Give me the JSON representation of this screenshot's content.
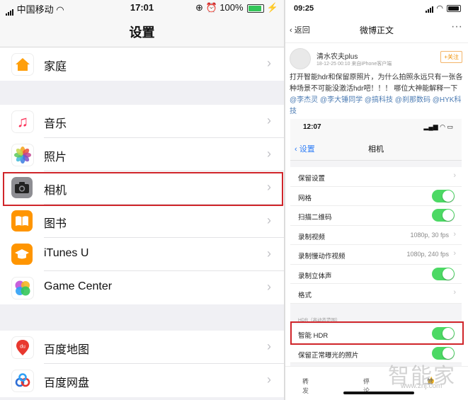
{
  "left": {
    "status": {
      "carrier": "中国移动",
      "time": "17:01",
      "battery": "100%"
    },
    "nav_title": "设置",
    "groups": [
      {
        "items": [
          {
            "label": "家庭",
            "icon": "home-icon",
            "color": "#ffffff"
          }
        ]
      },
      {
        "items": [
          {
            "label": "音乐",
            "icon": "music-icon",
            "color": "#ffffff"
          },
          {
            "label": "照片",
            "icon": "photos-icon",
            "color": "#ffffff"
          },
          {
            "label": "相机",
            "icon": "camera-icon",
            "color": "#8e8e93"
          },
          {
            "label": "图书",
            "icon": "books-icon",
            "color": "#ff9500"
          },
          {
            "label": "iTunes U",
            "icon": "itunes-u-icon",
            "color": "#ff9500"
          },
          {
            "label": "Game Center",
            "icon": "game-center-icon",
            "color": "#ffffff"
          }
        ]
      },
      {
        "items": [
          {
            "label": "百度地图",
            "icon": "baidu-map-icon",
            "color": "#ffffff"
          },
          {
            "label": "百度网盘",
            "icon": "baidu-netdisk-icon",
            "color": "#ffffff"
          }
        ]
      }
    ],
    "highlighted": "相机",
    "highlight_color": "#d0252a"
  },
  "right": {
    "status": {
      "time": "09:25"
    },
    "nav": {
      "back": "返回",
      "title": "微博正文",
      "more": "···"
    },
    "post": {
      "username": "清水农夫plus",
      "meta": "18-12-25 00:10  来自iPhone客户端",
      "follow": "+关注",
      "text": "打开智能hdr和保留原照片，为什么拍照永远只有一张各种场景不可能没激活hdr吧！！！ 哪位大神能解释一下",
      "mentions": "@李杰灵 @李大锤同学 @搞科技 @刹那数码 @HYK科技"
    },
    "inner": {
      "status_time": "12:07",
      "back": "设置",
      "title": "相机",
      "rows": [
        {
          "label": "保留设置",
          "value": "",
          "type": "chevron"
        },
        {
          "label": "网格",
          "value": "",
          "type": "toggle"
        },
        {
          "label": "扫描二维码",
          "value": "",
          "type": "toggle"
        },
        {
          "label": "录制视频",
          "value": "1080p, 30 fps",
          "type": "chevron"
        },
        {
          "label": "录制慢动作视频",
          "value": "1080p, 240 fps",
          "type": "chevron"
        },
        {
          "label": "录制立体声",
          "value": "",
          "type": "toggle"
        },
        {
          "label": "格式",
          "value": "",
          "type": "chevron"
        }
      ],
      "hdr_section": "HDR（高动态范围）",
      "hdr_rows": [
        {
          "label": "智能 HDR",
          "type": "toggle"
        },
        {
          "label": "保留正常曝光的照片",
          "type": "toggle"
        }
      ],
      "toggle_color": "#4cd964"
    },
    "actions": {
      "repost": "转发",
      "comment": "评论",
      "like": "赞"
    },
    "watermark": "智能家",
    "watermark_url": "www.znj.com"
  }
}
